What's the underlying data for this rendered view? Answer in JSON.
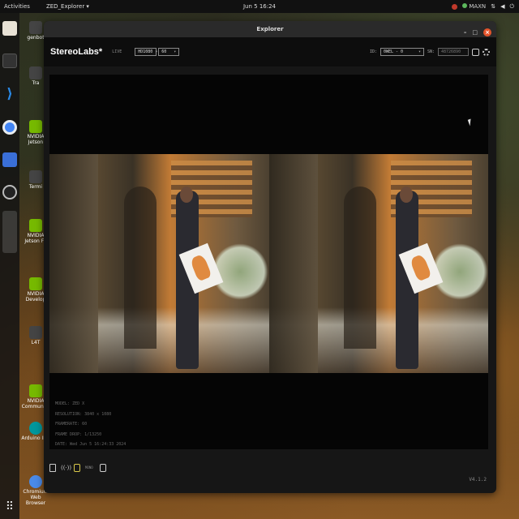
{
  "topbar": {
    "activities": "Activities",
    "app_menu": "ZED_Explorer ▾",
    "clock": "Jun 5  16:24",
    "tray_mode": "MAXN"
  },
  "dock": {
    "items": [
      "files-icon",
      "terminal-icon",
      "vscode-icon",
      "chrome-icon",
      "app-icon",
      "obs-icon",
      "window-preview",
      "app-grid-icon"
    ]
  },
  "desktop_icons": [
    {
      "label": "genbot",
      "icon": "home-icon"
    },
    {
      "label": "Tra",
      "icon": "trash-icon"
    },
    {
      "label": "NVIDIA Jetson",
      "icon": "nvidia-icon"
    },
    {
      "label": "Termi",
      "icon": "terminal-icon"
    },
    {
      "label": "NVIDIA Jetson Fo",
      "icon": "nvidia-icon"
    },
    {
      "label": "NVIDIA Develop",
      "icon": "nvidia-icon"
    },
    {
      "label": "L4T",
      "icon": "doc-icon"
    },
    {
      "label": "NVIDIA Community",
      "icon": "nvidia-icon"
    },
    {
      "label": "Arduino IDE",
      "icon": "arduino-icon"
    },
    {
      "label": "Chromium Web Browser",
      "icon": "chromium-icon"
    }
  ],
  "window": {
    "title": "Explorer",
    "brand": "StereoLabs*",
    "live_label": "LIVE",
    "resolution_select": "HD1080",
    "fps_select": "60",
    "id_label": "ID:",
    "id_select": "0WEL - 0",
    "sn_label": "SN:",
    "sn_value": "48726890",
    "info": {
      "model": "MODEL: ZED X",
      "resolution": "RESOLUTION: 3840 x 1080",
      "framerate": "FRAMERATE: 60",
      "frame_drop": "FRAME DROP: 1/13250",
      "date": "DATE: Wed Jun 5 16:24:33 2024"
    },
    "bottom_label": "MONO",
    "version": "V4.1.2"
  }
}
